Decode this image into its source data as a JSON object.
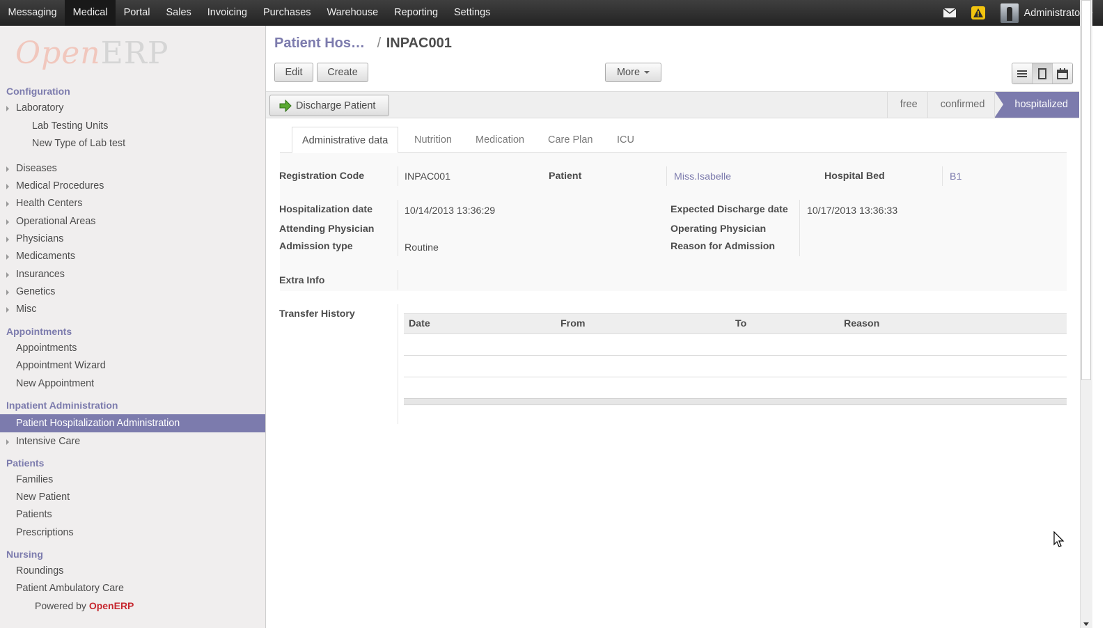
{
  "topbar": {
    "menu": [
      "Messaging",
      "Medical",
      "Portal",
      "Sales",
      "Invoicing",
      "Purchases",
      "Warehouse",
      "Reporting",
      "Settings"
    ],
    "active_menu": "Medical",
    "user": "Administrator"
  },
  "sidebar": {
    "logo_open": "Open",
    "logo_erp": "ERP",
    "sections": {
      "configuration": "Configuration",
      "appointments": "Appointments",
      "inpatient": "Inpatient Administration",
      "patients": "Patients",
      "nursing": "Nursing"
    },
    "config_items": [
      "Laboratory",
      "Lab Testing Units",
      "New Type of Lab test",
      "Diseases",
      "Medical Procedures",
      "Health Centers",
      "Operational Areas",
      "Physicians",
      "Medicaments",
      "Insurances",
      "Genetics",
      "Misc"
    ],
    "appointment_items": [
      "Appointments",
      "Appointment Wizard",
      "New Appointment"
    ],
    "inpatient_items": [
      "Patient Hospitalization Administration",
      "Intensive Care"
    ],
    "patient_items": [
      "Families",
      "New Patient",
      "Patients",
      "Prescriptions"
    ],
    "nursing_items": [
      "Roundings",
      "Patient Ambulatory Care"
    ],
    "powered_prefix": "Powered by",
    "powered_brand": "OpenERP"
  },
  "breadcrumb": {
    "parent": "Patient Hos…",
    "separator": "/",
    "current": "INPAC001"
  },
  "toolbar": {
    "edit": "Edit",
    "create": "Create",
    "more": "More"
  },
  "statusbar": {
    "discharge": "Discharge Patient",
    "stages": [
      "free",
      "confirmed",
      "hospitalized"
    ],
    "active_stage": "hospitalized"
  },
  "tabs": [
    "Administrative data",
    "Nutrition",
    "Medication",
    "Care Plan",
    "ICU"
  ],
  "form": {
    "registration_code_label": "Registration Code",
    "registration_code": "INPAC001",
    "patient_label": "Patient",
    "patient": "Miss.Isabelle",
    "hospital_bed_label": "Hospital Bed",
    "hospital_bed": "B1",
    "hosp_date_label": "Hospitalization date",
    "hosp_date": "10/14/2013 13:36:29",
    "exp_discharge_label": "Expected Discharge date",
    "exp_discharge": "10/17/2013 13:36:33",
    "attending_label": "Attending Physician",
    "operating_label": "Operating Physician",
    "admission_type_label": "Admission type",
    "admission_type": "Routine",
    "reason_label": "Reason for Admission",
    "extra_info_label": "Extra Info",
    "transfer_history_label": "Transfer History"
  },
  "transfer_table": {
    "columns": [
      "Date",
      "From",
      "To",
      "Reason"
    ],
    "rows": []
  },
  "colors": {
    "accent": "#7c7bad",
    "topbar": "#2b2b2b",
    "brand_red": "#c6272f"
  }
}
